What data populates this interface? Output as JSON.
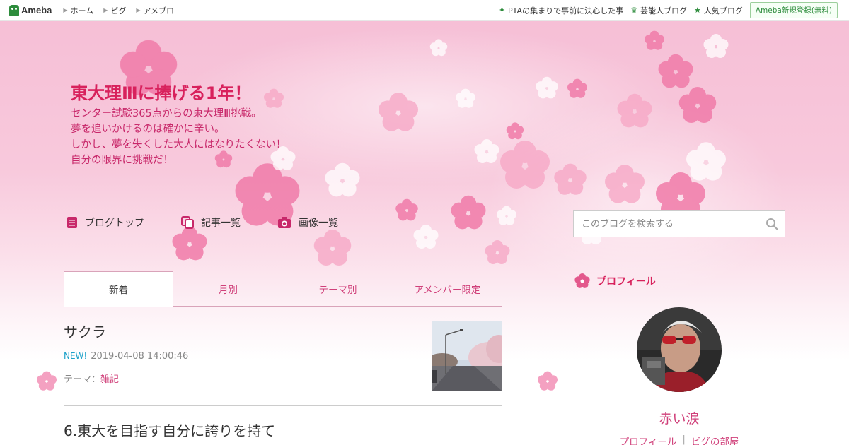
{
  "topbar": {
    "logo": "Ameba",
    "nav": [
      "ホーム",
      "ピグ",
      "アメブロ"
    ],
    "right_links": [
      {
        "icon": "sparkle-icon",
        "label": "PTAの集まりで事前に決心した事"
      },
      {
        "icon": "crown-icon",
        "label": "芸能人ブログ"
      },
      {
        "icon": "star-icon",
        "label": "人気ブログ"
      }
    ],
    "signup": "Ameba新規登録(無料)"
  },
  "blog": {
    "title": "東大理Ⅲに捧げる1年！",
    "description": "センター試験365点からの東大理Ⅲ挑戦。\n夢を追いかけるのは確かに辛い。\nしかし、夢を失くした大人にはなりたくない！\n自分の限界に挑戦だ！"
  },
  "blog_nav": {
    "top": "ブログトップ",
    "articles": "記事一覧",
    "images": "画像一覧"
  },
  "search": {
    "placeholder": "このブログを検索する"
  },
  "tabs": [
    "新着",
    "月別",
    "テーマ別",
    "アメンバー限定"
  ],
  "articles": [
    {
      "title": "サクラ",
      "new_badge": "NEW!",
      "datetime": "2019-04-08 14:00:46",
      "theme_label": "テーマ：",
      "theme": "雑記"
    },
    {
      "title": "6.東大を目指す自分に誇りを持て"
    }
  ],
  "profile": {
    "heading": "プロフィール",
    "name": "赤い涙",
    "link1": "プロフィール",
    "link2": "ピグの部屋"
  },
  "colors": {
    "accent": "#d8215c",
    "link": "#d0407a",
    "ameba_green": "#2d8c3c",
    "new_badge": "#1da1c9"
  }
}
